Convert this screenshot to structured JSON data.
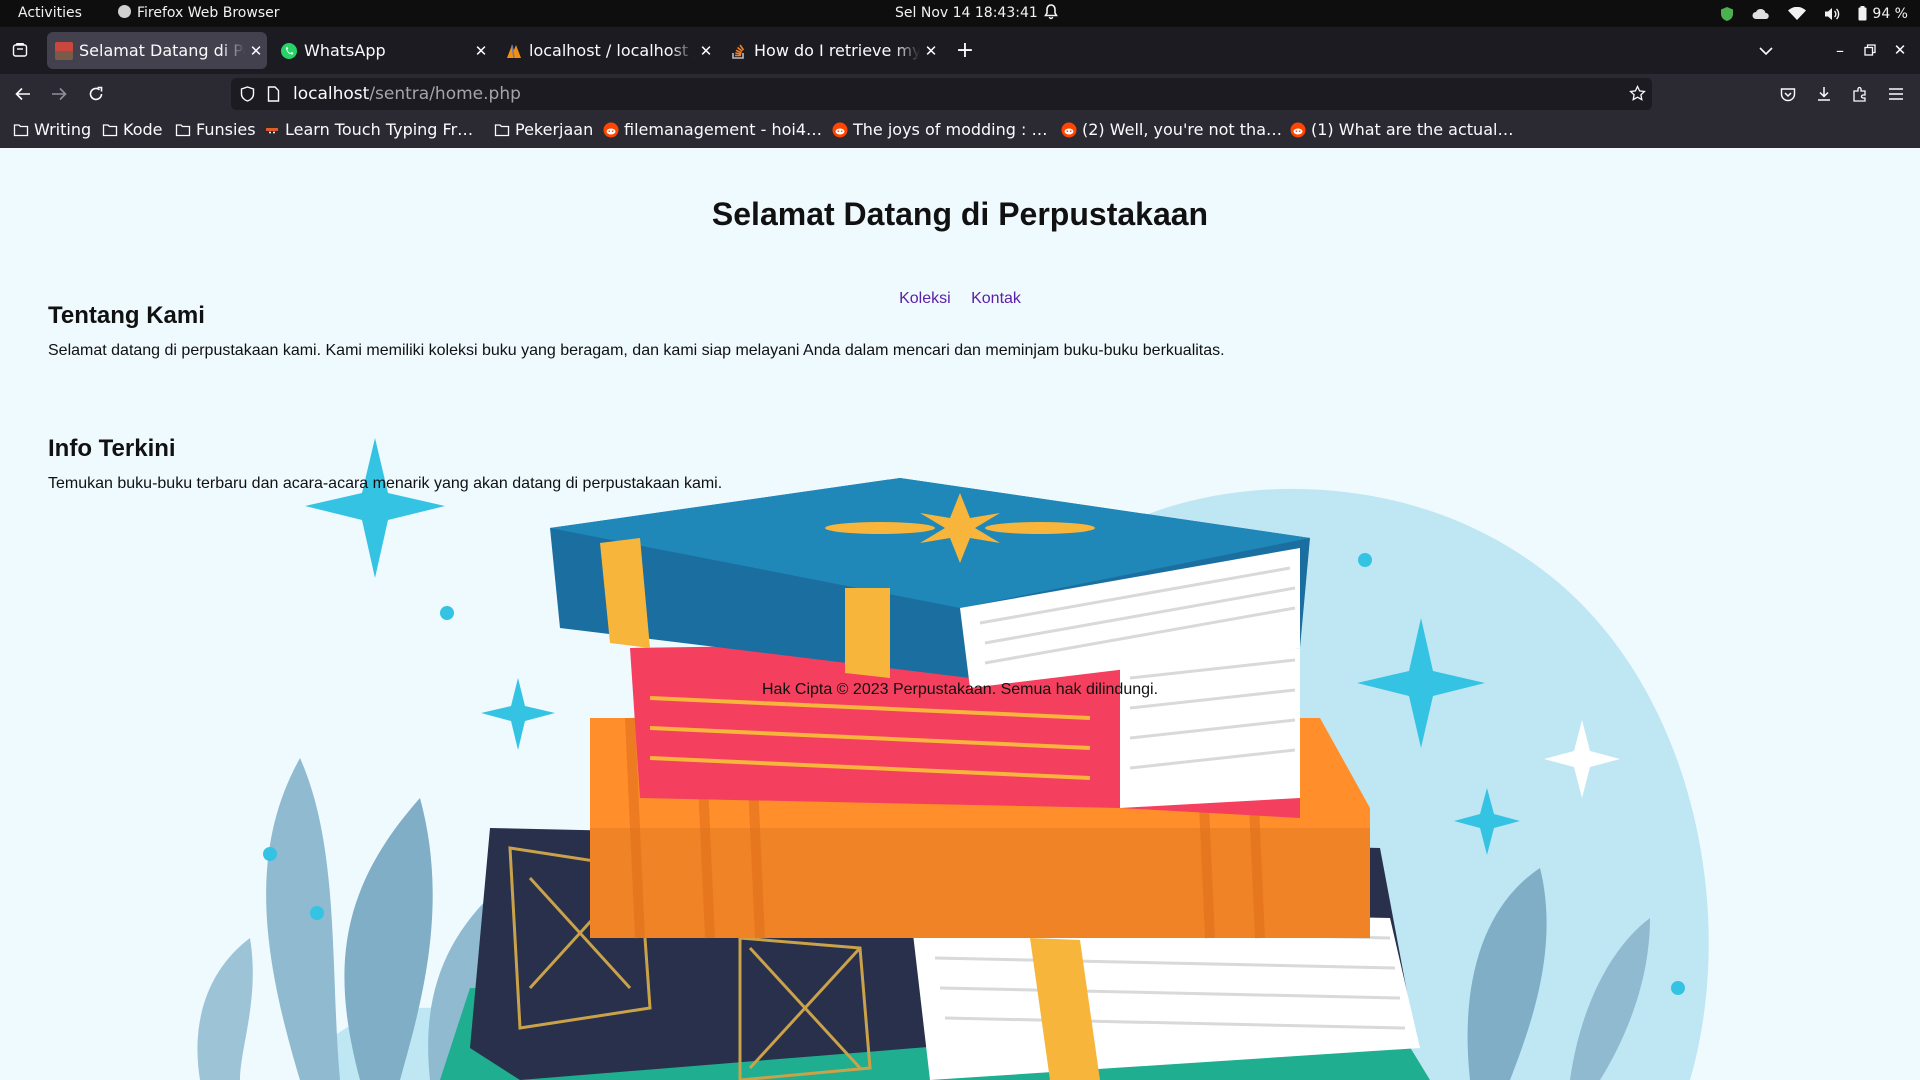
{
  "system": {
    "activities": "Activities",
    "app_name": "Firefox Web Browser",
    "clock": "Sel Nov 14  18:43:41",
    "battery": "94 %"
  },
  "tabs": [
    {
      "title": "Selamat Datang di Perpustakaan",
      "active": true,
      "icon": "library-favicon-icon"
    },
    {
      "title": "WhatsApp",
      "active": false,
      "icon": "whatsapp-icon"
    },
    {
      "title": "localhost / localhost / sentra",
      "active": false,
      "icon": "phpmyadmin-icon"
    },
    {
      "title": "How do I retrieve my",
      "active": false,
      "icon": "stackoverflow-icon"
    }
  ],
  "urlbar": {
    "host": "localhost",
    "path": "/sentra/home.php"
  },
  "bookmarks": [
    {
      "label": "Writing",
      "icon": "folder-icon"
    },
    {
      "label": "Kode",
      "icon": "folder-icon"
    },
    {
      "label": "Funsies",
      "icon": "folder-icon"
    },
    {
      "label": "Learn Touch Typing Fr…",
      "icon": "ninja-icon"
    },
    {
      "label": "Pekerjaan",
      "icon": "folder-icon"
    },
    {
      "label": "filemanagement - hoi4…",
      "icon": "reddit-icon"
    },
    {
      "label": "The joys of modding : …",
      "icon": "reddit-icon"
    },
    {
      "label": "(2) Well, you're not tha…",
      "icon": "reddit-icon"
    },
    {
      "label": "(1) What are the actual…",
      "icon": "reddit-icon"
    }
  ],
  "page": {
    "title": "Selamat Datang di Perpustakaan",
    "nav": [
      "Koleksi",
      "Kontak"
    ],
    "about_heading": "Tentang Kami",
    "about_text": "Selamat datang di perpustakaan kami. Kami memiliki koleksi buku yang beragam, dan kami siap melayani Anda dalam mencari dan meminjam buku-buku berkualitas.",
    "news_heading": "Info Terkini",
    "news_text": "Temukan buku-buku terbaru dan acara-acara menarik yang akan datang di perpustakaan kami.",
    "footer": "Hak Cipta © 2023 Perpustakaan. Semua hak dilindungi."
  },
  "colors": {
    "page_bg": "#effaff",
    "link": "#5a20a8",
    "browser_chrome": "#2b2a33"
  }
}
